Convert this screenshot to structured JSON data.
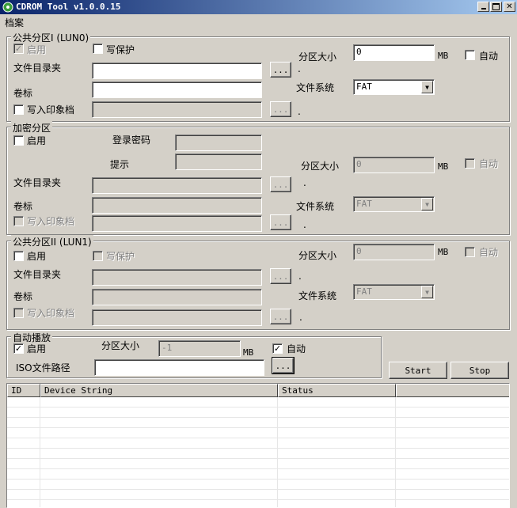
{
  "window": {
    "title": "CDROM Tool v1.0.0.15"
  },
  "menu": {
    "file": "档案"
  },
  "lun0": {
    "group_label": "公共分区I (LUN0)",
    "enable": "启用",
    "write_protect": "写保护",
    "file_dir": "文件目录夹",
    "volume": "卷标",
    "write_image": "写入印象档",
    "partition_size": "分区大小",
    "size_value": "0",
    "unit": "MB",
    "auto": "自动",
    "file_system": "文件系统",
    "fs_value": "FAT",
    "browse": "...",
    "dot": "."
  },
  "encrypted": {
    "group_label": "加密分区",
    "enable": "启用",
    "login_password": "登录密码",
    "hint": "提示",
    "file_dir": "文件目录夹",
    "volume": "卷标",
    "write_image": "写入印象档",
    "partition_size": "分区大小",
    "size_value": "0",
    "unit": "MB",
    "auto": "自动",
    "file_system": "文件系统",
    "fs_value": "FAT",
    "browse": "...",
    "dot": "."
  },
  "lun1": {
    "group_label": "公共分区II (LUN1)",
    "enable": "启用",
    "write_protect": "写保护",
    "file_dir": "文件目录夹",
    "volume": "卷标",
    "write_image": "写入印象档",
    "partition_size": "分区大小",
    "size_value": "0",
    "unit": "MB",
    "auto": "自动",
    "file_system": "文件系统",
    "fs_value": "FAT",
    "browse": "...",
    "dot": "."
  },
  "autorun": {
    "group_label": "自动播放",
    "enable": "启用",
    "partition_size": "分区大小",
    "size_value": "-1",
    "unit": "MB",
    "auto": "自动",
    "iso_path": "ISO文件路径",
    "browse": "..."
  },
  "actions": {
    "start": "Start",
    "stop": "Stop"
  },
  "devices": {
    "columns": [
      "ID",
      "Device String",
      "Status",
      ""
    ]
  }
}
